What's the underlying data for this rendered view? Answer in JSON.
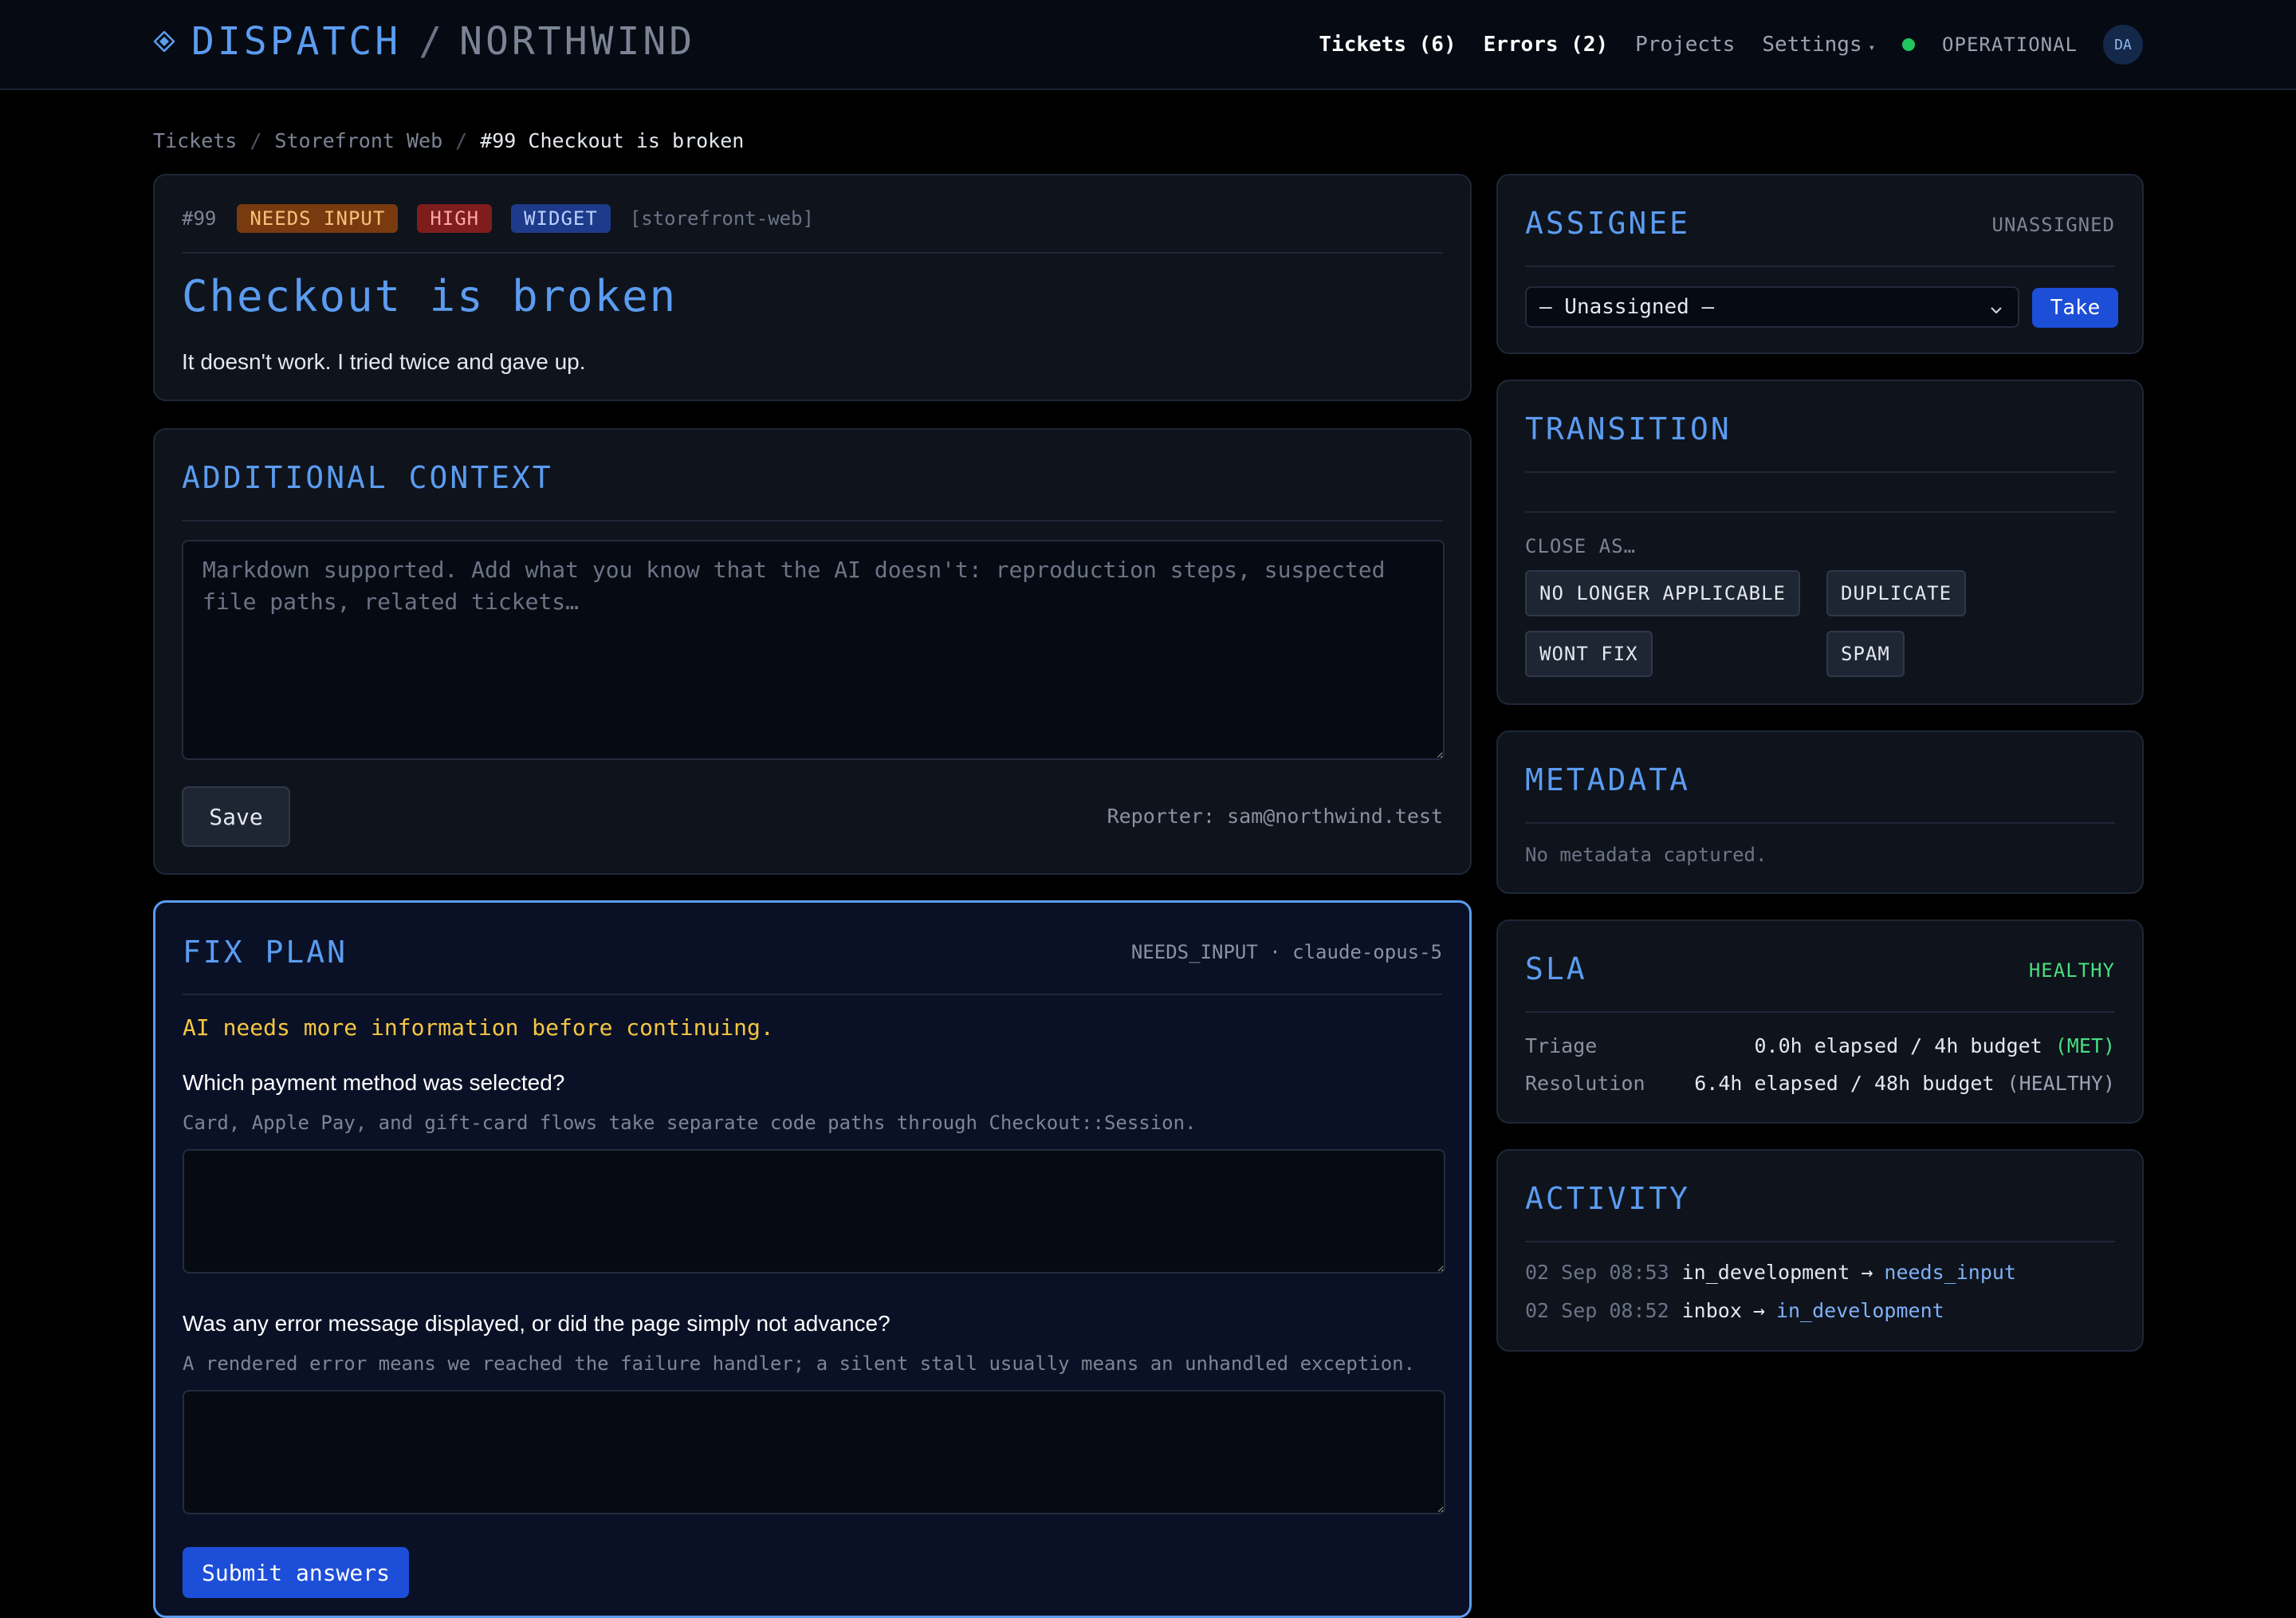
{
  "header": {
    "brand_name": "DISPATCH",
    "brand_separator": "/",
    "org_name": "NORTHWIND",
    "nav": {
      "tickets": "Tickets (6)",
      "errors": "Errors (2)",
      "projects": "Projects",
      "settings": "Settings",
      "settings_caret": "▾"
    },
    "status_text": "OPERATIONAL",
    "avatar_initials": "DA",
    "colors": {
      "accent": "#5b9cf0",
      "status_ok": "#22c55e"
    }
  },
  "breadcrumb": {
    "items": [
      "Tickets",
      "Storefront Web"
    ],
    "separator": "/",
    "current": "#99 Checkout is broken"
  },
  "ticket": {
    "number": "#99",
    "badges": {
      "status": "NEEDS INPUT",
      "priority": "HIGH",
      "source": "WIDGET"
    },
    "project": "[storefront-web]",
    "title": "Checkout is broken",
    "description": "It doesn't work. I tried twice and gave up."
  },
  "context": {
    "title": "ADDITIONAL CONTEXT",
    "placeholder": "Markdown supported. Add what you know that the AI doesn't: reproduction steps, suspected file paths, related tickets…",
    "save_label": "Save",
    "reporter": "Reporter: sam@northwind.test"
  },
  "fix_plan": {
    "title": "FIX PLAN",
    "status_line": "NEEDS_INPUT · claude-opus-5",
    "warning": "AI needs more information before continuing.",
    "questions": [
      {
        "label": "Which payment method was selected?",
        "hint": "Card, Apple Pay, and gift-card flows take separate code paths through Checkout::Session."
      },
      {
        "label": "Was any error message displayed, or did the page simply not advance?",
        "hint": "A rendered error means we reached the failure handler; a silent stall usually means an unhandled exception."
      }
    ],
    "submit_label": "Submit answers"
  },
  "assignee": {
    "title": "ASSIGNEE",
    "status": "UNASSIGNED",
    "selected": "— Unassigned —",
    "take_label": "Take"
  },
  "transition": {
    "title": "TRANSITION",
    "close_label": "CLOSE AS…",
    "options": [
      "NO LONGER APPLICABLE",
      "DUPLICATE",
      "WONT FIX",
      "SPAM"
    ]
  },
  "metadata": {
    "title": "METADATA",
    "empty": "No metadata captured."
  },
  "sla": {
    "title": "SLA",
    "health": "HEALTHY",
    "rows": [
      {
        "name": "Triage",
        "value": "0.0h elapsed / 4h budget",
        "state": "(MET)"
      },
      {
        "name": "Resolution",
        "value": "6.4h elapsed / 48h budget",
        "state": "(HEALTHY)"
      }
    ]
  },
  "activity": {
    "title": "ACTIVITY",
    "entries": [
      {
        "time": "02 Sep 08:53",
        "from": "in_development",
        "arrow": "→",
        "to": "needs_input"
      },
      {
        "time": "02 Sep 08:52",
        "from": "inbox",
        "arrow": "→",
        "to": "in_development"
      }
    ]
  }
}
